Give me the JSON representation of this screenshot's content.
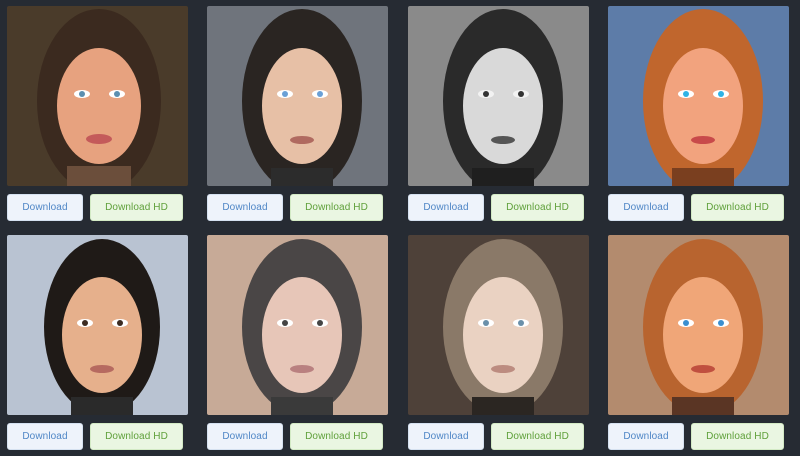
{
  "buttons": {
    "download_label": "Download",
    "download_hd_label": "Download HD"
  },
  "cards": [
    {
      "style": "painted-warm",
      "bg": "#4a3b2a",
      "skin": "#e7a27f",
      "hair": "#3b2a1f"
    },
    {
      "style": "painted-cool",
      "bg": "#6f747c",
      "skin": "#e7c0a6",
      "hair": "#2a2522"
    },
    {
      "style": "pencil-sketch",
      "bg": "#8a8a8a",
      "skin": "#d9d9d9",
      "hair": "#2a2a2a"
    },
    {
      "style": "painted-bright",
      "bg": "#5d7ca8",
      "skin": "#f2a37e",
      "hair": "#c0662d"
    },
    {
      "style": "painted-light",
      "bg": "#b9c3d2",
      "skin": "#e6b08c",
      "hair": "#1f1a17"
    },
    {
      "style": "sketch-warm",
      "bg": "#c7aa97",
      "skin": "#e7c6b8",
      "hair": "#4a4646"
    },
    {
      "style": "painted-muted",
      "bg": "#4e4139",
      "skin": "#ead2c2",
      "hair": "#8a7968"
    },
    {
      "style": "painted-orange",
      "bg": "#b38b6e",
      "skin": "#f0a678",
      "hair": "#b8642f"
    }
  ]
}
